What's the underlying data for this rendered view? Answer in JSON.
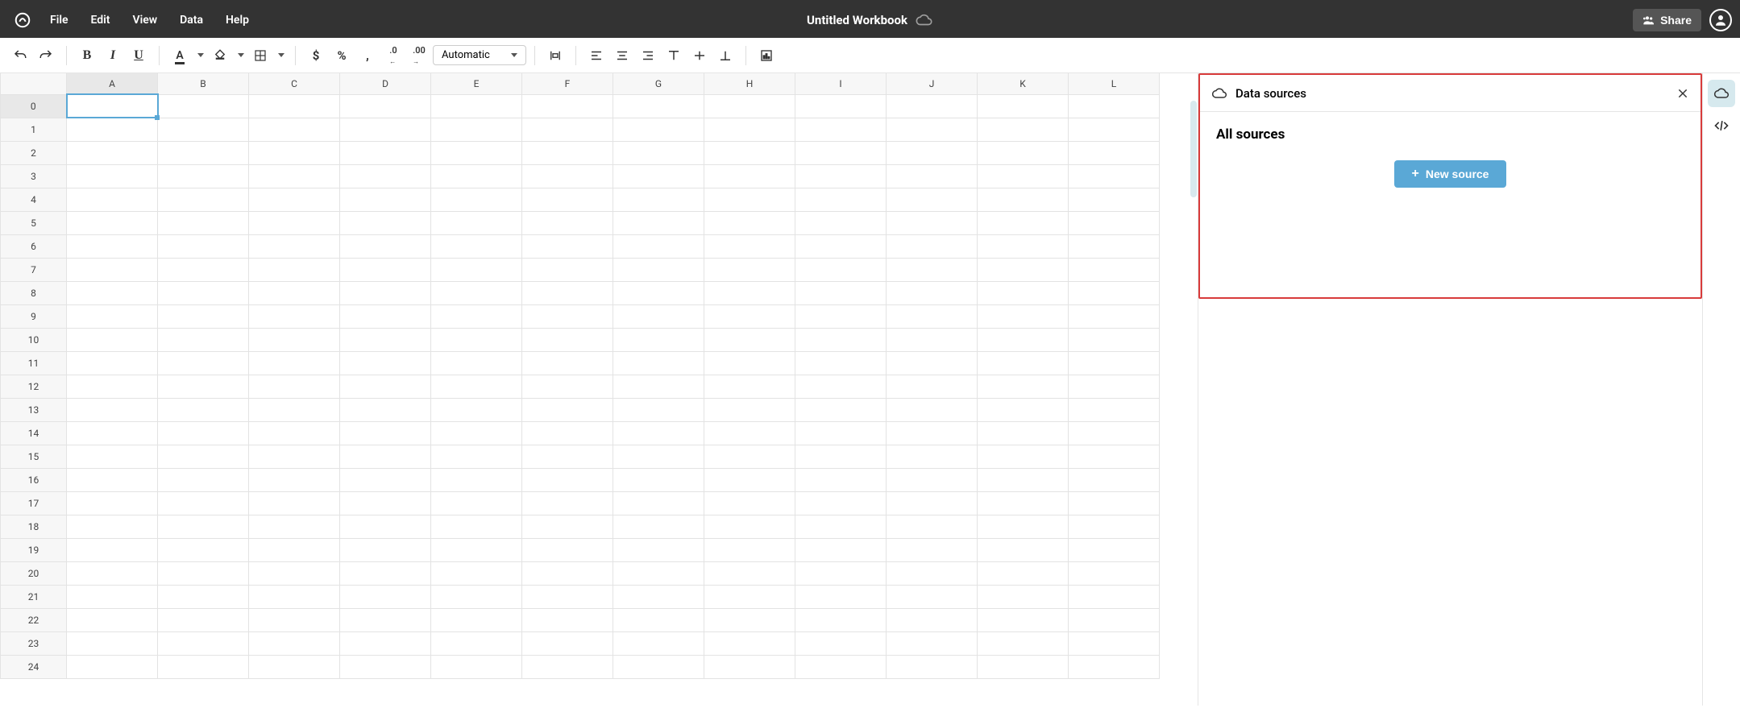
{
  "menubar": {
    "title": "Untitled Workbook",
    "menus": [
      "File",
      "Edit",
      "View",
      "Data",
      "Help"
    ],
    "share_label": "Share"
  },
  "toolbar": {
    "format_selector": "Automatic"
  },
  "sheet": {
    "columns": [
      "A",
      "B",
      "C",
      "D",
      "E",
      "F",
      "G",
      "H",
      "I",
      "J",
      "K",
      "L"
    ],
    "rows": [
      "0",
      "1",
      "2",
      "3",
      "4",
      "5",
      "6",
      "7",
      "8",
      "9",
      "10",
      "11",
      "12",
      "13",
      "14",
      "15",
      "16",
      "17",
      "18",
      "19",
      "20",
      "21",
      "22",
      "23",
      "24"
    ],
    "selected_cell": {
      "col": "A",
      "row": "0"
    }
  },
  "panel": {
    "title": "Data sources",
    "heading": "All sources",
    "new_source_label": "New source"
  }
}
